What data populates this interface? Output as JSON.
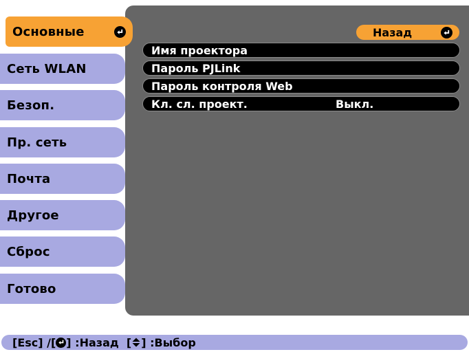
{
  "sidebar": {
    "items": [
      {
        "label": "Основные"
      },
      {
        "label": "Сеть WLAN"
      },
      {
        "label": "Безоп."
      },
      {
        "label": "Пр. сеть"
      },
      {
        "label": "Почта"
      },
      {
        "label": "Другое"
      },
      {
        "label": "Сброс"
      },
      {
        "label": "Готово"
      }
    ],
    "active_index": 0
  },
  "main": {
    "back_label": "Назад",
    "rows": [
      {
        "label": "Имя проектора",
        "value": ""
      },
      {
        "label": "Пароль PJLink",
        "value": ""
      },
      {
        "label": "Пароль контроля Web",
        "value": ""
      },
      {
        "label": "Кл. сл. проект.",
        "value": "Выкл."
      }
    ]
  },
  "help": {
    "esc_text": "[Esc] /[",
    "back_text": "] :Назад  [",
    "select_text": "] :Выбор"
  },
  "colors": {
    "accent": "#f7a234",
    "tab": "#a8a9e1",
    "panel": "#666666"
  }
}
